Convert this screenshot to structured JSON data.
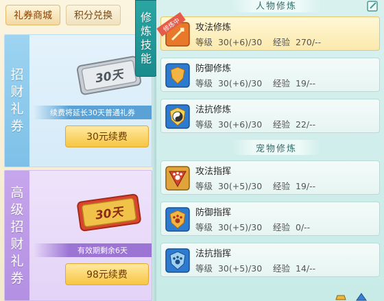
{
  "shop": {
    "tabs": [
      {
        "label": "礼券商城",
        "active": true
      },
      {
        "label": "积分兑换",
        "active": false
      }
    ],
    "cards": [
      {
        "title_chars": [
          "招",
          "财",
          "礼",
          "券"
        ],
        "ticket_text": "30天",
        "note": "续费将延长30天普通礼券",
        "button": "30元续费"
      },
      {
        "title_chars": [
          "高",
          "级",
          "招",
          "财",
          "礼",
          "券"
        ],
        "ticket_text": "30天",
        "note": "有效期剩余6天",
        "button": "98元续费"
      }
    ]
  },
  "side_tab": {
    "chars": [
      "修",
      "炼",
      "技",
      "能"
    ]
  },
  "skills": {
    "person_title": "人物修炼",
    "pet_title": "宠物修炼",
    "person": [
      {
        "name": "攻法修炼",
        "info": "等级  30(+6)/30    经验  270/--",
        "badge": "修炼中",
        "active": true,
        "icon": "sword-icon"
      },
      {
        "name": "防御修炼",
        "info": "等级  30(+6)/30    经验  19/--",
        "active": false,
        "icon": "shield-icon"
      },
      {
        "name": "法抗修炼",
        "info": "等级  30(+6)/30    经验  22/--",
        "active": false,
        "icon": "yin-yang-icon"
      }
    ],
    "pet": [
      {
        "name": "攻法指挥",
        "info": "等级  30(+5)/30    经验  19/--",
        "icon": "paw-attack-icon"
      },
      {
        "name": "防御指挥",
        "info": "等级  30(+5)/30    经验  0/--",
        "icon": "paw-shield-icon"
      },
      {
        "name": "法抗指挥",
        "info": "等级  30(+5)/30    经验  14/--",
        "icon": "paw-magic-icon"
      }
    ]
  },
  "colors": {
    "teal": "#1a8b8d",
    "gold": "#f7c542",
    "highlight": "#fbe9ad"
  }
}
